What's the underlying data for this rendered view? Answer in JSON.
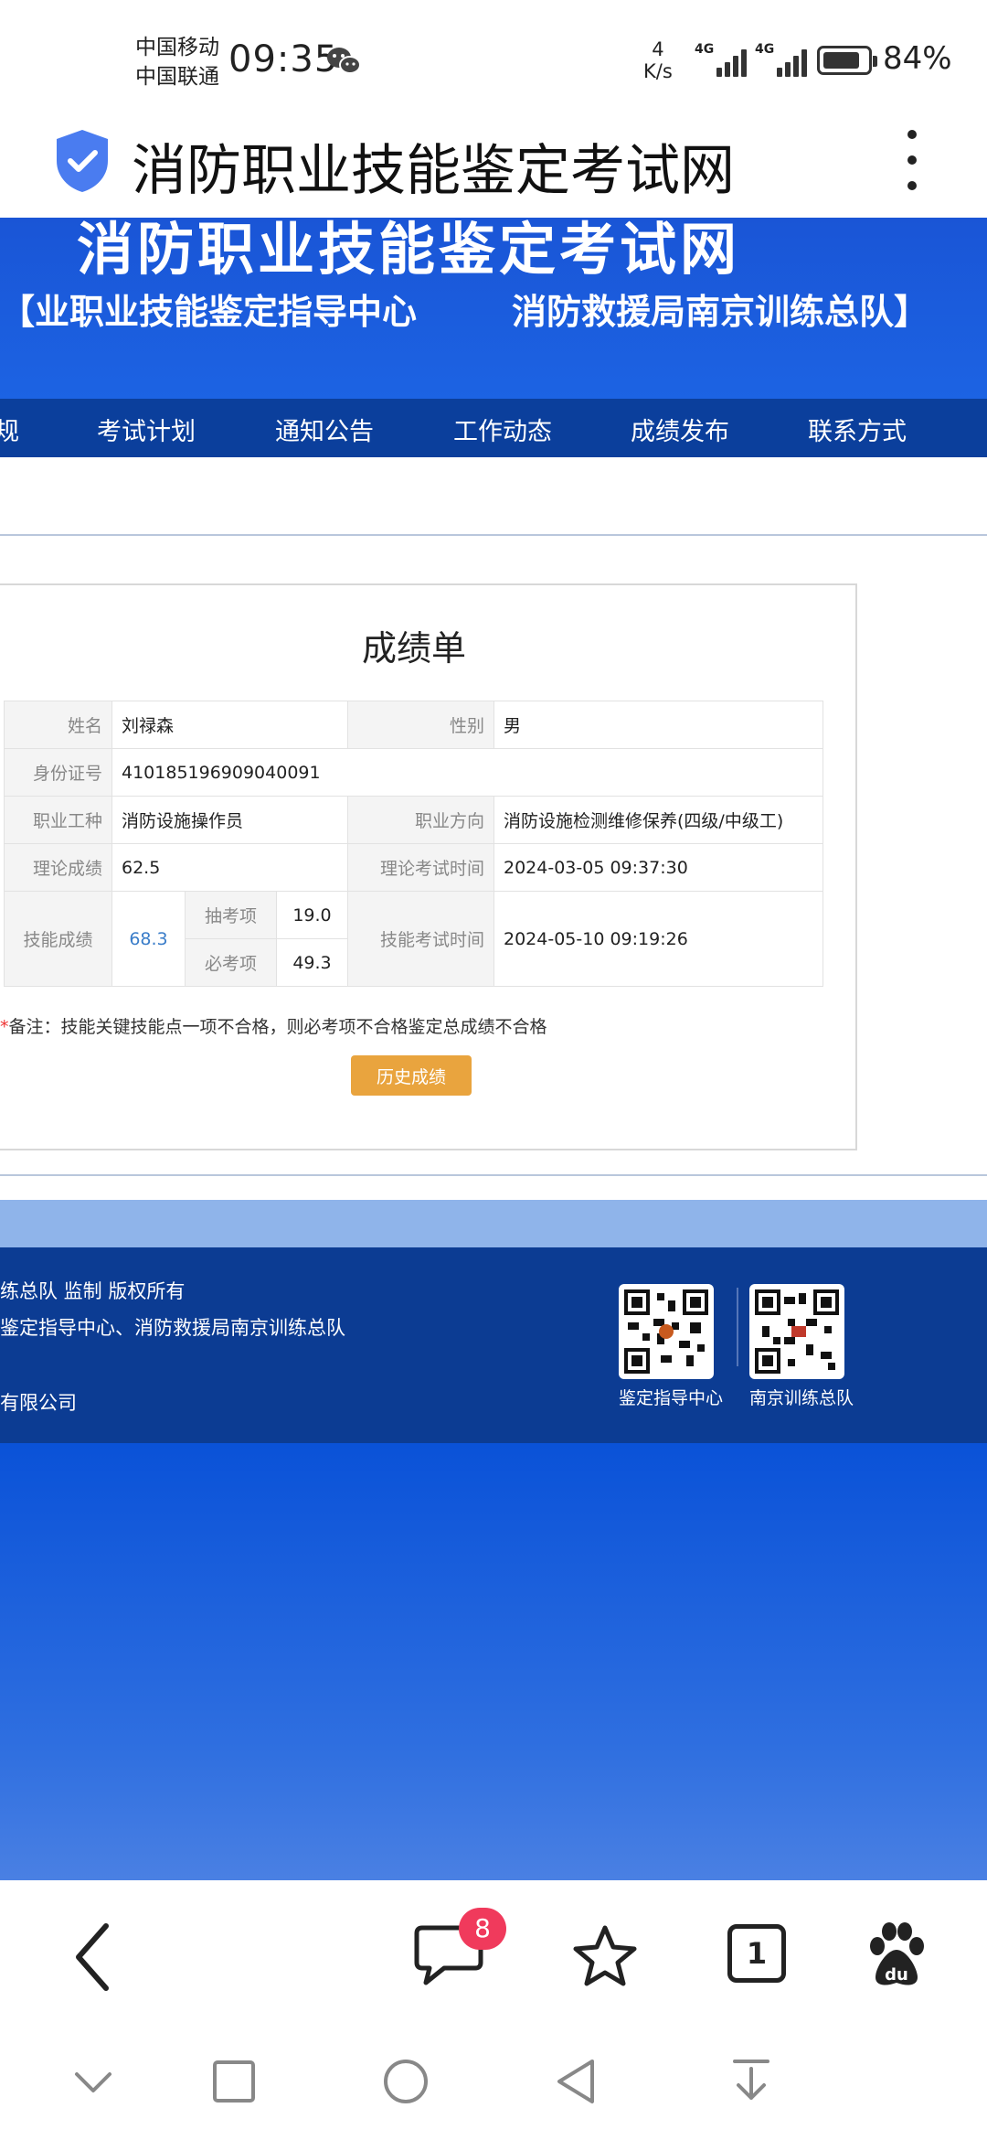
{
  "status_bar": {
    "carrier_1": "中国移动",
    "carrier_2": "中国联通",
    "time": "09:35",
    "speed_value": "4",
    "speed_unit": "K/s",
    "signal_1": "4G",
    "signal_2": "4G",
    "battery": "84%",
    "battery_level": 0.84
  },
  "browser": {
    "title": "消防职业技能鉴定考试网",
    "tab_count": "1",
    "comment_badge": "8"
  },
  "banner": {
    "title": "消防职业技能鉴定考试网",
    "subtitle_left": "【业职业技能鉴定指导中心",
    "subtitle_right": "消防救援局南京训练总队】"
  },
  "nav": {
    "items": [
      "规",
      "考试计划",
      "通知公告",
      "工作动态",
      "成绩发布",
      "联系方式"
    ]
  },
  "score_sheet": {
    "title": "成绩单",
    "name_label": "姓名",
    "name_value": "刘禄森",
    "gender_label": "性别",
    "gender_value": "男",
    "id_label": "身份证号",
    "id_value": "410185196909040091",
    "job_label": "职业工种",
    "job_value": "消防设施操作员",
    "direction_label": "职业方向",
    "direction_value": "消防设施检测维修保养(四级/中级工)",
    "theory_label": "理论成绩",
    "theory_value": "62.5",
    "theory_time_label": "理论考试时间",
    "theory_time_value": "2024-03-05 09:37:30",
    "skill_label": "技能成绩",
    "skill_value": "68.3",
    "draw_label": "抽考项",
    "draw_value": "19.0",
    "required_label": "必考项",
    "required_value": "49.3",
    "skill_time_label": "技能考试时间",
    "skill_time_value": "2024-05-10 09:19:26",
    "note_star": "*",
    "note": "备注：技能关键技能点一项不合格，则必考项不合格鉴定总成绩不合格",
    "history_button": "历史成绩"
  },
  "footer": {
    "line_1": "练总队 监制 版权所有",
    "line_2": "鉴定指导中心、消防救援局南京训练总队",
    "line_3": "有限公司",
    "qr_1_label": "鉴定指导中心",
    "qr_2_label": "南京训练总队"
  },
  "colors": {
    "banner_blue": "#1c5ee0",
    "nav_blue": "#0b3f9c",
    "footer_blue": "#0c3c93",
    "button_orange": "#e9a43e",
    "badge_red": "#f03a5c",
    "skill_value_blue": "#3a7dc9"
  }
}
